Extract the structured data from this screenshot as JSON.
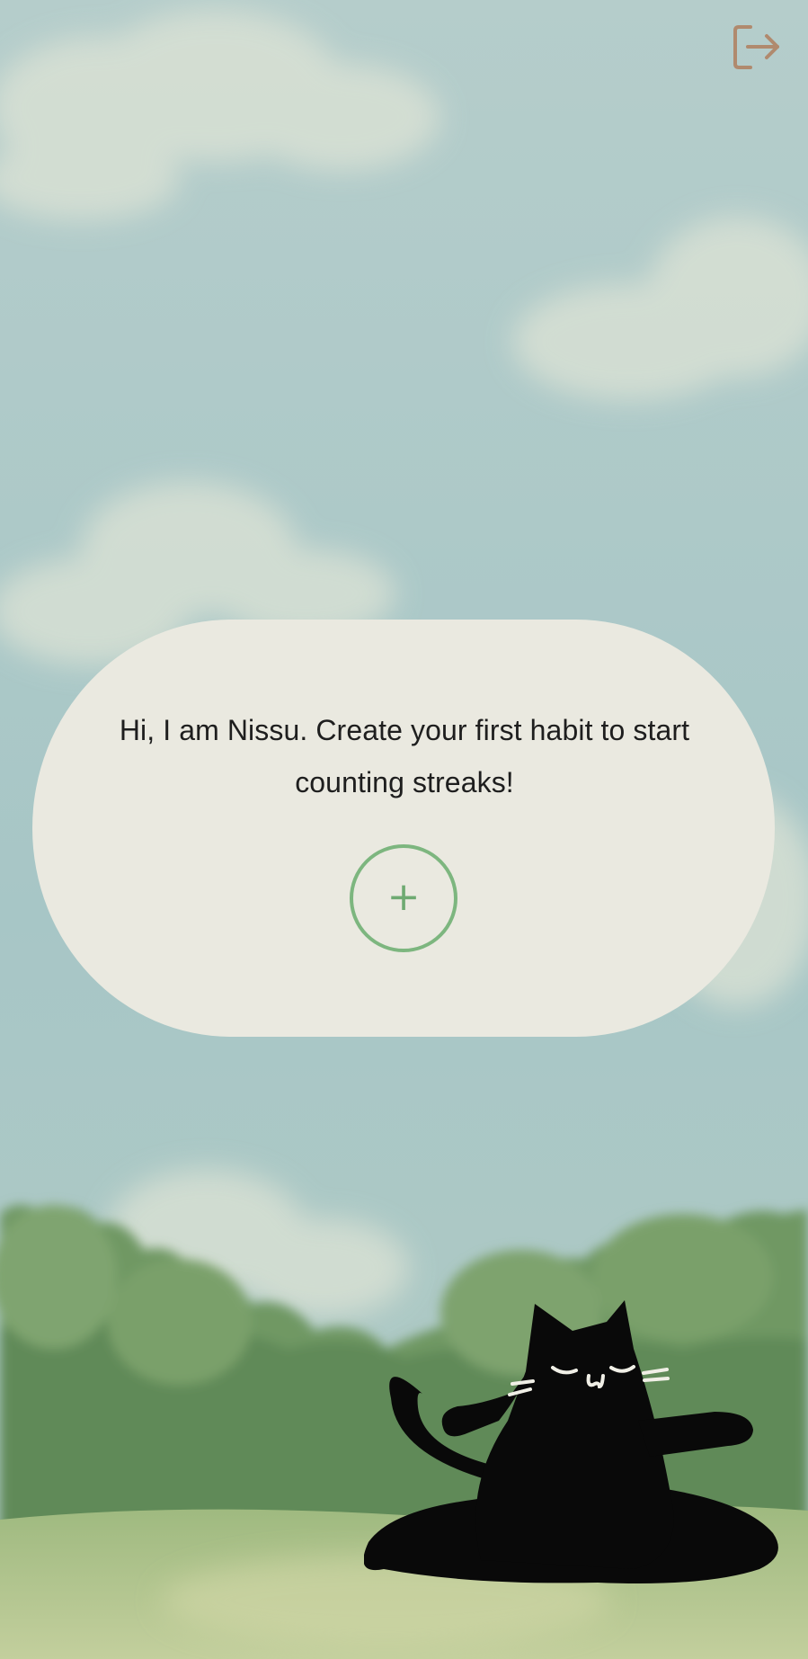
{
  "app": {
    "logout_icon": "logout-icon",
    "message": "Hi, I am Nissu. Create your first habit to start counting streaks!",
    "add_icon": "plus-icon",
    "add_symbol": "+",
    "mascot": "cat-mascot"
  },
  "colors": {
    "sky": "#b6cfcf",
    "bubble": "#eae9e0",
    "accent_green": "#7db67f",
    "logout": "#b08a6e",
    "cat": "#090909",
    "trees": "#6f9864",
    "grass": "#b6c891"
  }
}
